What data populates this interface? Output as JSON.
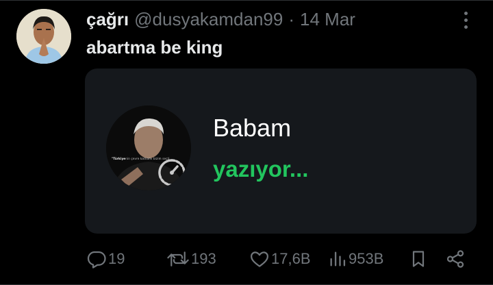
{
  "author": {
    "display_name": "çağrı",
    "handle": "@dusyakamdan99",
    "separator": "·",
    "date": "14 Mar",
    "avatar_icon": "praying-man-avatar"
  },
  "tweet": {
    "text": "abartma be king"
  },
  "media": {
    "caption_bold": "\"Türkiye",
    "caption_rest": "nin çevre katliamı bizim seçti",
    "name": "Babam",
    "status": "yazıyor...",
    "status_color": "#22c55e",
    "overlay_icon": "speedometer-icon"
  },
  "actions": {
    "replies": "19",
    "reposts": "193",
    "likes": "17,6B",
    "views": "953B",
    "bookmark_icon": "bookmark-icon",
    "share_icon": "share-icon"
  },
  "colors": {
    "background": "#000000",
    "card": "#15181c",
    "text_primary": "#e7e9ea",
    "text_secondary": "#71767b",
    "accent_green": "#22c55e"
  }
}
